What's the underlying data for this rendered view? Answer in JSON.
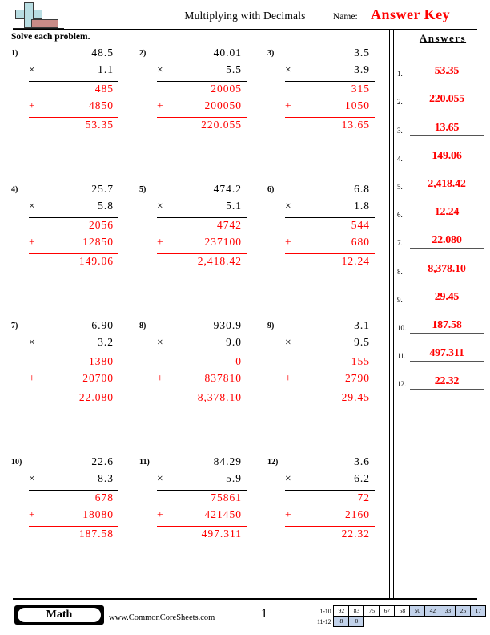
{
  "header": {
    "title": "Multiplying with Decimals",
    "name_label": "Name:",
    "name_value": "Answer Key",
    "logo_icon": "plus-block-logo"
  },
  "instruction": "Solve each problem.",
  "answers_heading": "Answers",
  "problems": [
    {
      "number": "1)",
      "multiplicand": "48.5",
      "op": "×",
      "multiplier": "1.1",
      "partials": [
        {
          "op": "",
          "value": "485"
        },
        {
          "op": "+",
          "value": "4850"
        }
      ],
      "answer": "53.35"
    },
    {
      "number": "2)",
      "multiplicand": "40.01",
      "op": "×",
      "multiplier": "5.5",
      "partials": [
        {
          "op": "",
          "value": "20005"
        },
        {
          "op": "+",
          "value": "200050"
        }
      ],
      "answer": "220.055"
    },
    {
      "number": "3)",
      "multiplicand": "3.5",
      "op": "×",
      "multiplier": "3.9",
      "partials": [
        {
          "op": "",
          "value": "315"
        },
        {
          "op": "+",
          "value": "1050"
        }
      ],
      "answer": "13.65"
    },
    {
      "number": "4)",
      "multiplicand": "25.7",
      "op": "×",
      "multiplier": "5.8",
      "partials": [
        {
          "op": "",
          "value": "2056"
        },
        {
          "op": "+",
          "value": "12850"
        }
      ],
      "answer": "149.06"
    },
    {
      "number": "5)",
      "multiplicand": "474.2",
      "op": "×",
      "multiplier": "5.1",
      "partials": [
        {
          "op": "",
          "value": "4742"
        },
        {
          "op": "+",
          "value": "237100"
        }
      ],
      "answer": "2,418.42"
    },
    {
      "number": "6)",
      "multiplicand": "6.8",
      "op": "×",
      "multiplier": "1.8",
      "partials": [
        {
          "op": "",
          "value": "544"
        },
        {
          "op": "+",
          "value": "680"
        }
      ],
      "answer": "12.24"
    },
    {
      "number": "7)",
      "multiplicand": "6.90",
      "op": "×",
      "multiplier": "3.2",
      "partials": [
        {
          "op": "",
          "value": "1380"
        },
        {
          "op": "+",
          "value": "20700"
        }
      ],
      "answer": "22.080"
    },
    {
      "number": "8)",
      "multiplicand": "930.9",
      "op": "×",
      "multiplier": "9.0",
      "partials": [
        {
          "op": "",
          "value": "0"
        },
        {
          "op": "+",
          "value": "837810"
        }
      ],
      "answer": "8,378.10"
    },
    {
      "number": "9)",
      "multiplicand": "3.1",
      "op": "×",
      "multiplier": "9.5",
      "partials": [
        {
          "op": "",
          "value": "155"
        },
        {
          "op": "+",
          "value": "2790"
        }
      ],
      "answer": "29.45"
    },
    {
      "number": "10)",
      "multiplicand": "22.6",
      "op": "×",
      "multiplier": "8.3",
      "partials": [
        {
          "op": "",
          "value": "678"
        },
        {
          "op": "+",
          "value": "18080"
        }
      ],
      "answer": "187.58"
    },
    {
      "number": "11)",
      "multiplicand": "84.29",
      "op": "×",
      "multiplier": "5.9",
      "partials": [
        {
          "op": "",
          "value": "75861"
        },
        {
          "op": "+",
          "value": "421450"
        }
      ],
      "answer": "497.311"
    },
    {
      "number": "12)",
      "multiplicand": "3.6",
      "op": "×",
      "multiplier": "6.2",
      "partials": [
        {
          "op": "",
          "value": "72"
        },
        {
          "op": "+",
          "value": "2160"
        }
      ],
      "answer": "22.32"
    }
  ],
  "answer_list": [
    {
      "label": "1.",
      "value": "53.35"
    },
    {
      "label": "2.",
      "value": "220.055"
    },
    {
      "label": "3.",
      "value": "13.65"
    },
    {
      "label": "4.",
      "value": "149.06"
    },
    {
      "label": "5.",
      "value": "2,418.42"
    },
    {
      "label": "6.",
      "value": "12.24"
    },
    {
      "label": "7.",
      "value": "22.080"
    },
    {
      "label": "8.",
      "value": "8,378.10"
    },
    {
      "label": "9.",
      "value": "29.45"
    },
    {
      "label": "10.",
      "value": "187.58"
    },
    {
      "label": "11.",
      "value": "497.311"
    },
    {
      "label": "12.",
      "value": "22.32"
    }
  ],
  "footer": {
    "subject": "Math",
    "site_url": "www.CommonCoreSheets.com",
    "page_number": "1",
    "score_rows": [
      {
        "label": "1-10",
        "cells": [
          {
            "value": "92",
            "shaded": false
          },
          {
            "value": "83",
            "shaded": false
          },
          {
            "value": "75",
            "shaded": false
          },
          {
            "value": "67",
            "shaded": false
          },
          {
            "value": "58",
            "shaded": false
          },
          {
            "value": "50",
            "shaded": true
          },
          {
            "value": "42",
            "shaded": true
          },
          {
            "value": "33",
            "shaded": true
          },
          {
            "value": "25",
            "shaded": true
          },
          {
            "value": "17",
            "shaded": true
          }
        ]
      },
      {
        "label": "11-12",
        "cells": [
          {
            "value": "8",
            "shaded": true
          },
          {
            "value": "0",
            "shaded": true
          }
        ]
      }
    ]
  },
  "colors": {
    "answer_red": "#ff0000",
    "logo_blue": "#b8dde2",
    "logo_red": "#c98b87",
    "score_shade": "#c2d2ea"
  }
}
